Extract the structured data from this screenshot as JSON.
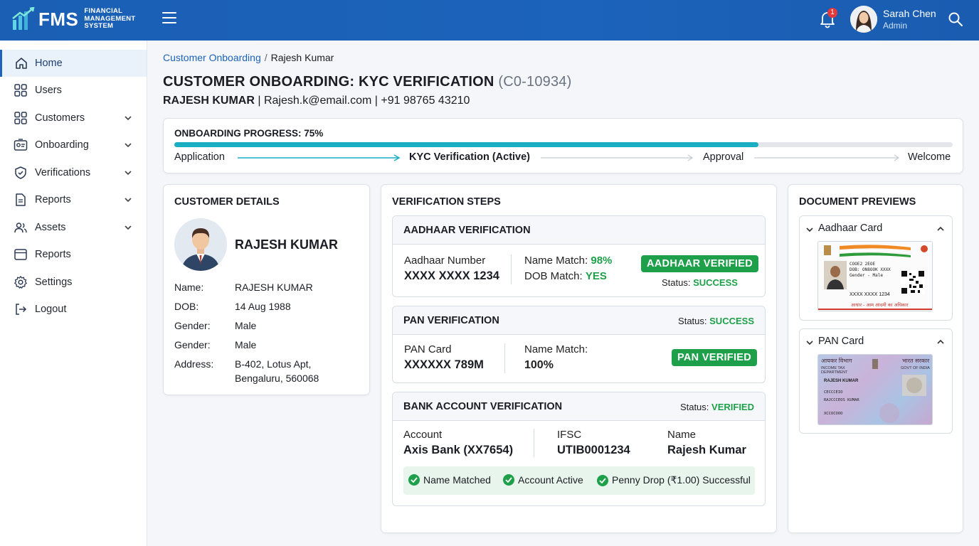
{
  "app": {
    "logo_text": "FMS",
    "logo_sub_1": "FINANCIAL",
    "logo_sub_2": "MANAGEMENT",
    "logo_sub_3": "SYSTEM",
    "notification_count": "1",
    "user_name": "Sarah Chen",
    "user_role": "Admin"
  },
  "sidebar": {
    "items": [
      {
        "label": "Home",
        "icon": "home-icon"
      },
      {
        "label": "Users",
        "icon": "grid-icon"
      },
      {
        "label": "Customers",
        "icon": "grid-icon"
      },
      {
        "label": "Onboarding",
        "icon": "id-card-icon"
      },
      {
        "label": "Verifications",
        "icon": "shield-check-icon"
      },
      {
        "label": "Reports",
        "icon": "document-icon"
      },
      {
        "label": "Assets",
        "icon": "users-icon"
      },
      {
        "label": "Reports",
        "icon": "browser-window-icon"
      },
      {
        "label": "Settings",
        "icon": "gear-icon"
      },
      {
        "label": "Logout",
        "icon": "logout-icon"
      }
    ]
  },
  "breadcrumb": {
    "parent": "Customer Onboarding",
    "separator": "/",
    "current": "Rajesh Kumar"
  },
  "page": {
    "title": "CUSTOMER ONBOARDING: KYC VERIFICATION",
    "customer_id": "(C0-10934)",
    "customer_name": "RAJESH KUMAR",
    "contact_rest": " | Rajesh.k@email.com | +91 98765 43210"
  },
  "progress": {
    "title": "ONBOARDING PROGRESS: 75%",
    "percent": 75,
    "steps": [
      "Application",
      "KYC Verification (Active)",
      "Approval",
      "Welcome"
    ]
  },
  "customer_details": {
    "title": "CUSTOMER DETAILS",
    "name_big": "RAJESH KUMAR",
    "fields": [
      {
        "label": "Name:",
        "value": "RAJESH KUMAR"
      },
      {
        "label": "DOB:",
        "value": "14 Aug 1988"
      },
      {
        "label": "Gender:",
        "value": "Male"
      },
      {
        "label": "Gender:",
        "value": "Male"
      },
      {
        "label": "Address:",
        "value": "B-402, Lotus Apt, Bengaluru, 560068"
      }
    ]
  },
  "verification": {
    "title": "VERIFICATION STEPS",
    "aadhaar": {
      "title": "AADHAAR VERIFICATION",
      "number_label": "Aadhaar Number",
      "number_value": "XXXX XXXX 1234",
      "name_match_label": "Name Match:",
      "name_match_value": "98%",
      "dob_match_label": "DOB Match:",
      "dob_match_value": "YES",
      "badge": "AADHAAR VERIFIED",
      "status_label": "Status:",
      "status_value": "SUCCESS"
    },
    "pan": {
      "title": "PAN VERIFICATION",
      "status_label": "Status:",
      "status_value": "SUCCESS",
      "card_label": "PAN Card",
      "card_value": "XXXXXX 789M",
      "name_match_label": "Name Match:",
      "name_match_value": "100%",
      "badge": "PAN VERIFIED"
    },
    "bank": {
      "title": "BANK ACCOUNT VERIFICATION",
      "status_label": "Status:",
      "status_value": "VERIFIED",
      "account_label": "Account",
      "account_value": "Axis Bank (XX7654)",
      "ifsc_label": "IFSC",
      "ifsc_value": "UTIB0001234",
      "name_label": "Name",
      "name_value": "Rajesh Kumar",
      "checks": [
        "Name Matched",
        "Account Active",
        "Penny Drop (₹1.00) Successful"
      ]
    }
  },
  "documents": {
    "title": "DOCUMENT PREVIEWS",
    "aadhaar": {
      "label": "Aadhaar Card",
      "line1": "COOE2 2EOE",
      "line2": "DOB: ON8OOK XXXX",
      "line3": "Gender - Male",
      "number": "XXXX XXXX 1234",
      "footer": "आधार - आम आदमी का अधिकार"
    },
    "pan": {
      "label": "PAN Card",
      "hindi_left": "आयकर विभाग",
      "hindi_right": "भारत सरकार",
      "dept": "INCOME TAX DEPARTMENT",
      "govt": "GOVT OF INDIA",
      "name": "RAJESH KUMAR",
      "line1": "CECCCEIO",
      "line2": "RAJCCCEOS KUMAR",
      "line3": "XCCOCOOO"
    }
  },
  "colors": {
    "header_blue": "#1c63bb",
    "success_green": "#1ea04a",
    "progress_teal": "#1aaec2"
  }
}
